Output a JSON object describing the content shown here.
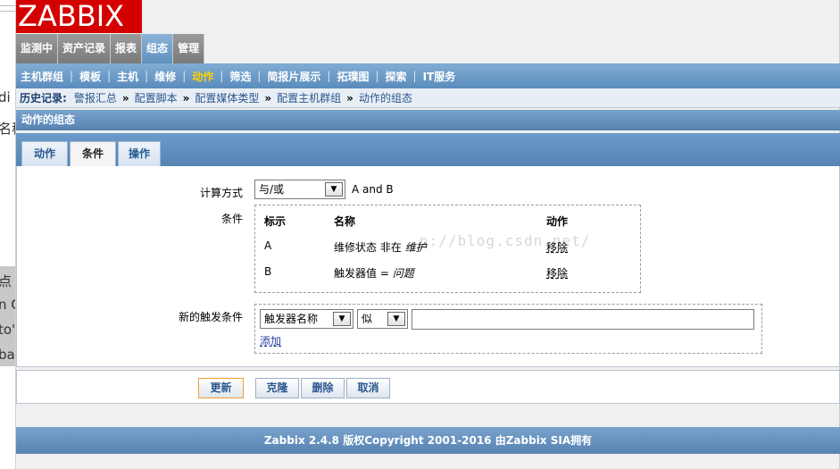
{
  "background_window": {
    "fragments": [
      "di",
      "名称",
      "点",
      "n C",
      "to'",
      "ba"
    ]
  },
  "logo": {
    "text": "ZABBIX",
    "color": "#d40000"
  },
  "main_menu": [
    {
      "label": "监测中",
      "active": false
    },
    {
      "label": "资产记录",
      "active": false
    },
    {
      "label": "报表",
      "active": false
    },
    {
      "label": "组态",
      "active": true
    },
    {
      "label": "管理",
      "active": false
    }
  ],
  "sub_menu": [
    {
      "label": "主机群组",
      "active": false
    },
    {
      "label": "模板",
      "active": false
    },
    {
      "label": "主机",
      "active": false
    },
    {
      "label": "维修",
      "active": false
    },
    {
      "label": "动作",
      "active": true
    },
    {
      "label": "筛选",
      "active": false
    },
    {
      "label": "简报片展示",
      "active": false
    },
    {
      "label": "拓璞图",
      "active": false
    },
    {
      "label": "探索",
      "active": false
    },
    {
      "label": "IT服务",
      "active": false
    }
  ],
  "history": {
    "label": "历史记录:",
    "crumbs": [
      "警报汇总",
      "配置脚本",
      "配置媒体类型",
      "配置主机群组",
      "动作的组态"
    ]
  },
  "section_title": "动作的组态",
  "tabs": [
    {
      "label": "动作",
      "active": false
    },
    {
      "label": "条件",
      "active": true
    },
    {
      "label": "操作",
      "active": false
    }
  ],
  "form": {
    "calc_label": "计算方式",
    "calc_value": "与/或",
    "calc_formula": "A and B",
    "conditions_label": "条件",
    "conditions_headers": [
      "标示",
      "名称",
      "动作"
    ],
    "conditions": [
      {
        "id": "A",
        "name_prefix": "维修状态 非在 ",
        "name_value": "维护",
        "action": "移除"
      },
      {
        "id": "B",
        "name_prefix": "触发器值 = ",
        "name_value": "问题",
        "action": "移除"
      }
    ],
    "watermark": "p://blog.csdn.net/",
    "new_condition_label": "新的触发条件",
    "new_condition_type": "触发器名称",
    "new_condition_operator": "似",
    "new_condition_value": "",
    "add_link": "添加"
  },
  "buttons": {
    "update": "更新",
    "clone": "克隆",
    "delete": "删除",
    "cancel": "取消"
  },
  "footer": "Zabbix 2.4.8 版权Copyright 2001-2016 由Zabbix SIA拥有",
  "colors": {
    "accent_blue": "#5f8fbf",
    "active_menu_yellow": "#ffd200",
    "link": "#2b3f9f"
  }
}
